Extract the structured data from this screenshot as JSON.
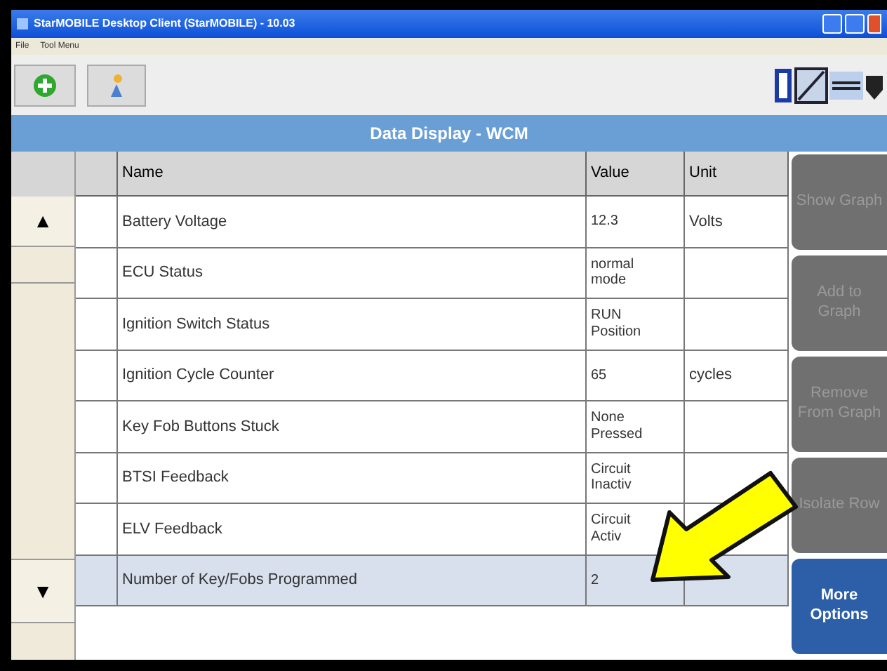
{
  "window": {
    "title": "StarMOBILE Desktop Client (StarMOBILE) - 10.03"
  },
  "menu": [
    "File",
    "Tool Menu"
  ],
  "header": {
    "title": "Data Display - WCM"
  },
  "scroll": {
    "up": "▲",
    "down": "▼"
  },
  "table": {
    "columns": [
      "Name",
      "Value",
      "Unit"
    ],
    "rows": [
      {
        "name": "Battery Voltage",
        "value": "12.3",
        "unit": "Volts",
        "selected": false
      },
      {
        "name": "ECU Status",
        "value": "normal mode",
        "unit": "",
        "selected": false
      },
      {
        "name": "Ignition Switch Status",
        "value": "RUN Position",
        "unit": "",
        "selected": false
      },
      {
        "name": "Ignition Cycle Counter",
        "value": "65",
        "unit": "cycles",
        "selected": false
      },
      {
        "name": "Key Fob Buttons Stuck",
        "value": "None Pressed",
        "unit": "",
        "selected": false
      },
      {
        "name": "BTSI Feedback",
        "value": "Circuit Inactiv",
        "unit": "",
        "selected": false
      },
      {
        "name": "ELV Feedback",
        "value": "Circuit Activ",
        "unit": "",
        "selected": false
      },
      {
        "name": "Number of Key/Fobs Programmed",
        "value": "2",
        "unit": "",
        "selected": true
      }
    ]
  },
  "actions": [
    {
      "label": "Show Graph",
      "disabled": true
    },
    {
      "label": "Add to Graph",
      "disabled": true
    },
    {
      "label": "Remove From Graph",
      "disabled": true
    },
    {
      "label": "Isolate Row",
      "disabled": true
    },
    {
      "label": "More Options",
      "disabled": false
    }
  ]
}
